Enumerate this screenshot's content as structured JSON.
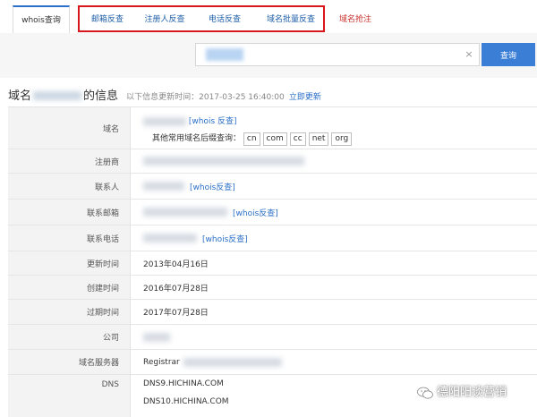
{
  "tabs": {
    "whois": "whois查询",
    "email": "邮箱反查",
    "registrant": "注册人反查",
    "phone": "电话反查",
    "batch": "域名批量反查",
    "register": "域名抢注"
  },
  "search": {
    "placeholder": "",
    "button": "查询",
    "clear": "×"
  },
  "info": {
    "prefix": "域名",
    "suffix": "的信息",
    "updated": "以下信息更新时间：2017-03-25 16:40:00",
    "refresh": "立即更新"
  },
  "rows": {
    "domain": {
      "label": "域名",
      "link": "[whois 反查]",
      "other_label": "其他常用域名后缀查询：",
      "suffixes": [
        "cn",
        "com",
        "cc",
        "net",
        "org"
      ]
    },
    "registrar": {
      "label": "注册商"
    },
    "contact": {
      "label": "联系人",
      "link": "[whois反查]"
    },
    "email": {
      "label": "联系邮箱",
      "link": "[whois反查]"
    },
    "phone": {
      "label": "联系电话",
      "link": "[whois反查]"
    },
    "updated": {
      "label": "更新时间",
      "value": "2013年04月16日"
    },
    "created": {
      "label": "创建时间",
      "value": "2016年07月28日"
    },
    "expires": {
      "label": "过期时间",
      "value": "2017年07月28日"
    },
    "company": {
      "label": "公司"
    },
    "server": {
      "label": "域名服务器",
      "value": "Registrar"
    },
    "dns": {
      "label": "DNS",
      "values": [
        "DNS9.HICHINA.COM",
        "DNS10.HICHINA.COM"
      ]
    }
  },
  "watermark": "德阳阳谈营销",
  "colors": {
    "accent": "#3a7fd5",
    "link": "#2a6fc9",
    "highlight": "#d9161c"
  }
}
